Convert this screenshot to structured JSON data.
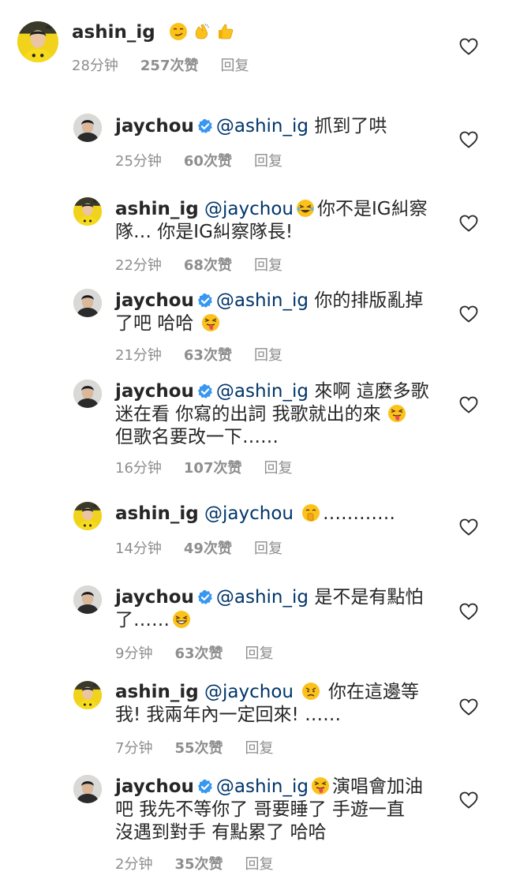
{
  "comments": [
    {
      "user": "ashin_ig",
      "verified": false,
      "mention": "",
      "lines": [
        ""
      ],
      "emojis": [
        "smirk",
        "clap",
        "thumbs-up"
      ],
      "time": "28分钟",
      "likes": "257次赞",
      "reply": "回复"
    },
    {
      "user": "jaychou",
      "verified": true,
      "mention": "@ashin_ig",
      "text": "抓到了哄",
      "time": "25分钟",
      "likes": "60次赞",
      "reply": "回复"
    },
    {
      "user": "ashin_ig",
      "verified": false,
      "mention": "@jaychou",
      "text1": "你不是IG糾察",
      "text2": "隊… 你是IG糾察隊長!",
      "time": "22分钟",
      "likes": "68次赞",
      "reply": "回复"
    },
    {
      "user": "jaychou",
      "verified": true,
      "mention": "@ashin_ig",
      "text1": "你的排版亂掉",
      "text2": "了吧 哈哈",
      "time": "21分钟",
      "likes": "63次赞",
      "reply": "回复"
    },
    {
      "user": "jaychou",
      "verified": true,
      "mention": "@ashin_ig",
      "text1": "來啊 這麼多歌",
      "text2": "迷在看 你寫的出詞 我歌就出的來",
      "text3": "但歌名要改一下……",
      "time": "16分钟",
      "likes": "107次赞",
      "reply": "回复"
    },
    {
      "user": "ashin_ig",
      "verified": false,
      "mention": "@jaychou",
      "text": "…………",
      "time": "14分钟",
      "likes": "49次赞",
      "reply": "回复"
    },
    {
      "user": "jaychou",
      "verified": true,
      "mention": "@ashin_ig",
      "text1": "是不是有點怕",
      "text2": "了……",
      "time": "9分钟",
      "likes": "63次赞",
      "reply": "回复"
    },
    {
      "user": "ashin_ig",
      "verified": false,
      "mention": "@jaychou",
      "text1": "你在這邊等",
      "text2": "我! 我兩年內一定回來! ……",
      "time": "7分钟",
      "likes": "55次赞",
      "reply": "回复"
    },
    {
      "user": "jaychou",
      "verified": true,
      "mention": "@ashin_ig",
      "text1": "演唱會加油",
      "text2": "吧 我先不等你了 哥要睡了 手遊一直",
      "text3": "沒遇到對手 有點累了 哈哈",
      "time": "2分钟",
      "likes": "35次赞",
      "reply": "回复"
    }
  ],
  "colors": {
    "mention": "#003569",
    "meta": "#8e8e8e",
    "verified": "#3897f0"
  }
}
